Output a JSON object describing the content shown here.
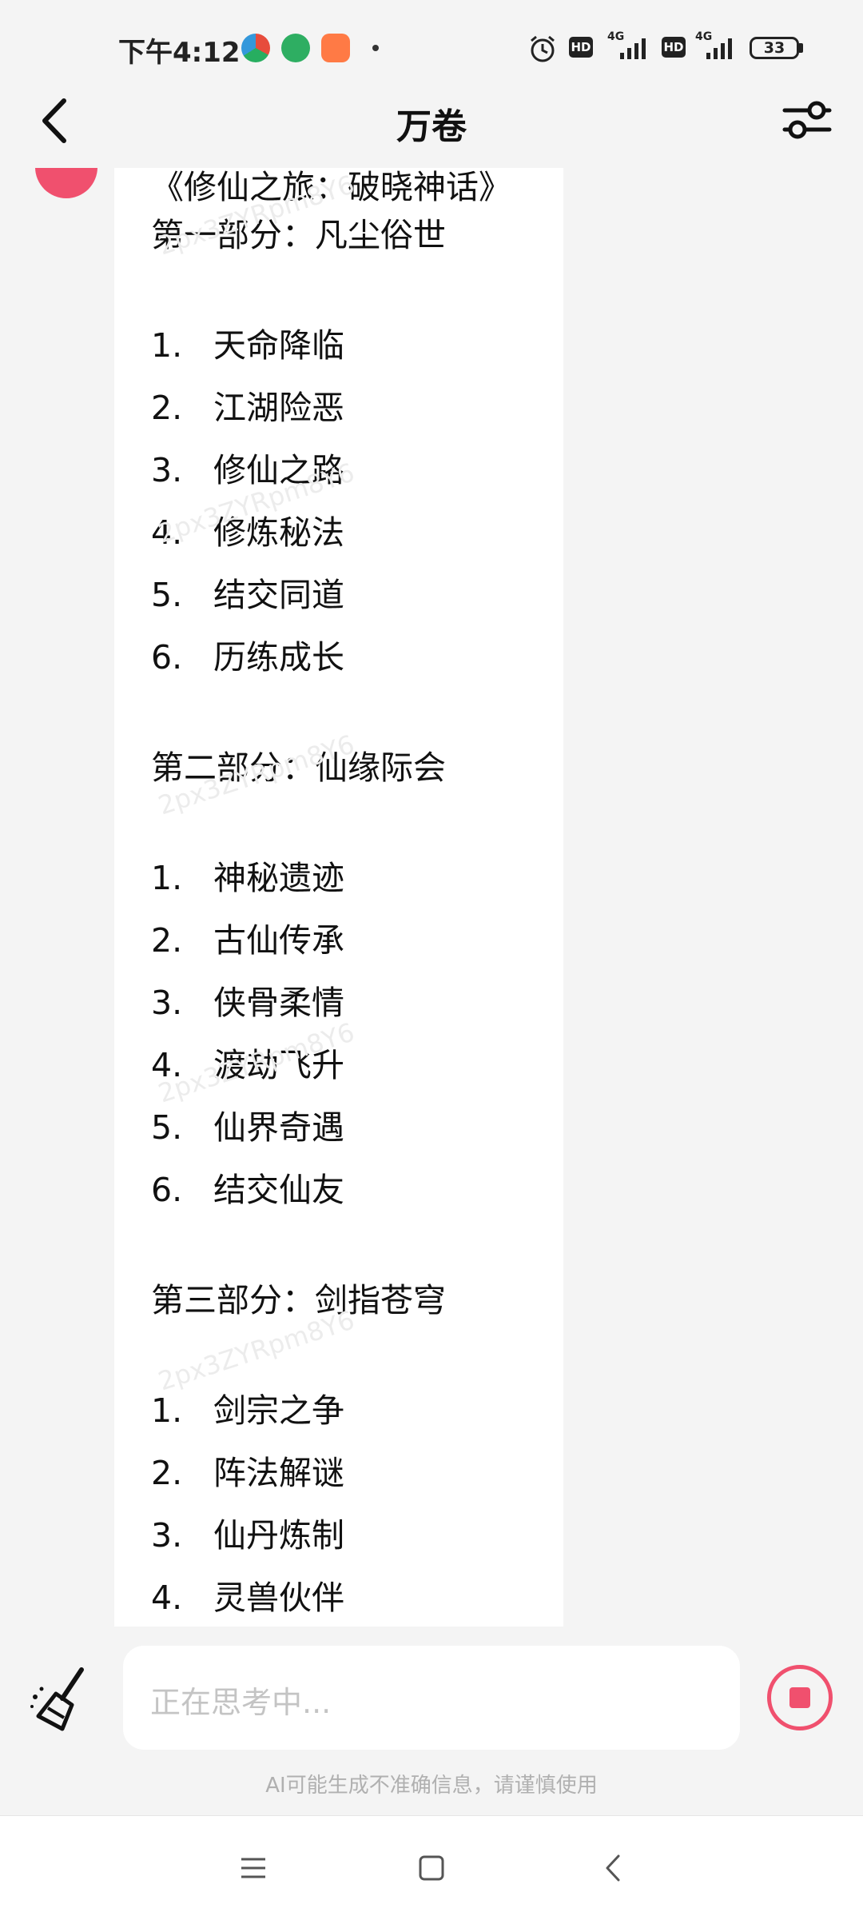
{
  "status_bar": {
    "time": "下午4:12",
    "hd1": "HD",
    "net1": "4G",
    "hd2": "HD",
    "net2": "4G",
    "battery": "33"
  },
  "header": {
    "title": "万卷",
    "back_icon": "chevron-left-icon",
    "filter_icon": "sliders-icon"
  },
  "message": {
    "lines": [
      {
        "text": "《修仙之旅：破晓神话》"
      },
      {
        "text": "第一部分：凡尘俗世"
      },
      {
        "num": "1.",
        "text": "天命降临"
      },
      {
        "num": "2.",
        "text": "江湖险恶"
      },
      {
        "num": "3.",
        "text": "修仙之路"
      },
      {
        "num": "4.",
        "text": "修炼秘法"
      },
      {
        "num": "5.",
        "text": "结交同道"
      },
      {
        "num": "6.",
        "text": "历练成长"
      },
      {
        "text": "第二部分：仙缘际会"
      },
      {
        "num": "1.",
        "text": "神秘遗迹"
      },
      {
        "num": "2.",
        "text": "古仙传承"
      },
      {
        "num": "3.",
        "text": "侠骨柔情"
      },
      {
        "num": "4.",
        "text": "渡劫飞升"
      },
      {
        "num": "5.",
        "text": "仙界奇遇"
      },
      {
        "num": "6.",
        "text": "结交仙友"
      },
      {
        "text": "第三部分：剑指苍穹"
      },
      {
        "num": "1.",
        "text": "剑宗之争"
      },
      {
        "num": "2.",
        "text": "阵法解谜"
      },
      {
        "num": "3.",
        "text": "仙丹炼制"
      },
      {
        "num": "4.",
        "text": "灵兽伙伴"
      }
    ],
    "watermark": "2px3ZYRpm8Y6"
  },
  "input": {
    "placeholder": "正在思考中...",
    "disclaimer": "AI可能生成不准确信息，请谨慎使用",
    "broom_icon": "broom-icon",
    "stop_icon": "stop-icon"
  },
  "nav": {
    "menu_icon": "menu-icon",
    "home_icon": "home-icon",
    "back_icon": "back-icon"
  },
  "colors": {
    "accent": "#f0506e",
    "background": "#f4f4f4",
    "bubble": "#ffffff"
  }
}
